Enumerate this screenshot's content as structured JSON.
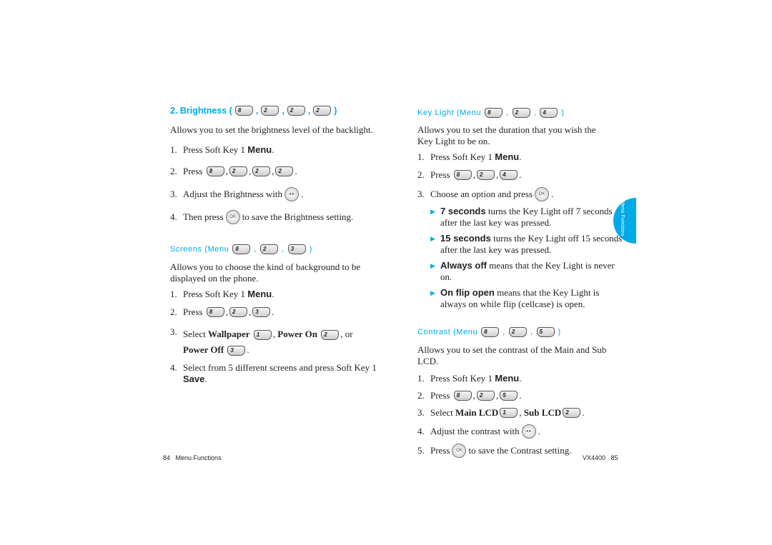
{
  "left_page": {
    "brightness": {
      "heading": "2. Brightness (",
      "heading_close": ")",
      "keys": [
        "8",
        "2",
        "2",
        "2"
      ],
      "description": "Allows you to set the brightness level of the backlight.",
      "steps": [
        {
          "num": "1.",
          "text": "Press Soft Key 1 ",
          "bold": "Menu",
          "end": "."
        },
        {
          "num": "2.",
          "text": "Press",
          "keys": [
            "8",
            "2",
            "2",
            "2"
          ]
        },
        {
          "num": "3.",
          "text": "Adjust the Brightness with",
          "icon": "navigation-key",
          "end": "."
        },
        {
          "num": "4.",
          "text": "Then press",
          "icon": "ok-key",
          "after": "to save the Brightness setting."
        }
      ]
    },
    "screens": {
      "heading": "Screens (Menu",
      "heading_close": ")",
      "keys": [
        "8",
        "2",
        "3"
      ],
      "description": "Allows you to choose the kind of background to be displayed on the phone.",
      "steps": [
        {
          "num": "1.",
          "text": "Press Soft Key 1 ",
          "bold": "Menu",
          "end": "."
        },
        {
          "num": "2.",
          "text": "Press",
          "keys": [
            "8",
            "2",
            "3"
          ]
        },
        {
          "num": "3.",
          "text": "Select",
          "options": [
            "Wallpaper",
            "Power On",
            "Power Off"
          ],
          "option_keys": [
            "1",
            "2",
            "3"
          ]
        },
        {
          "num": "4.",
          "text": "Select from 5 different screens and press Soft Key 1 ",
          "bold": "Save",
          "end": "."
        }
      ]
    },
    "footer": {
      "page": "84",
      "title": "Menu Functions"
    }
  },
  "right_page": {
    "key_light": {
      "heading": "Key Light (Menu",
      "heading_close": ")",
      "keys": [
        "8",
        "2",
        "4"
      ],
      "description": "Allows you to set the duration that you wish the Key Light to be on.",
      "steps": [
        {
          "num": "1.",
          "text": "Press Soft Key 1 ",
          "bold": "Menu",
          "end": "."
        },
        {
          "num": "2.",
          "text": "Press",
          "keys": [
            "8",
            "2",
            "4"
          ]
        },
        {
          "num": "3.",
          "text": "Choose an option and press",
          "icon": "ok-key",
          "end": "."
        }
      ],
      "options": [
        {
          "bold": "7 seconds",
          "text": " turns the Key Light off 7 seconds after the last key was pressed."
        },
        {
          "bold": "15 seconds",
          "text": " turns the Key Light off 15 seconds after the last key was pressed."
        },
        {
          "bold": "Always off",
          "text": " means that the Key Light is never on."
        },
        {
          "bold": "On flip open",
          "text": " means that the Key Light is always on while flip (cellcase) is open."
        }
      ]
    },
    "contrast": {
      "heading": "Contrast (Menu",
      "heading_close": ")",
      "keys": [
        "8",
        "2",
        "5"
      ],
      "description": "Allows you to set the contrast of the Main and Sub LCD.",
      "steps": [
        {
          "num": "1.",
          "text": "Press Soft Key 1 ",
          "bold": "Menu",
          "end": "."
        },
        {
          "num": "2.",
          "text": "Press",
          "keys": [
            "8",
            "2",
            "5"
          ]
        },
        {
          "num": "3.",
          "text": "Select",
          "options": [
            "Main LCD",
            "Sub LCD"
          ],
          "option_keys": [
            "1",
            "2"
          ]
        },
        {
          "num": "4.",
          "text": "Adjust the contrast with",
          "icon": "navigation-key",
          "end": "."
        },
        {
          "num": "5.",
          "text": "Press",
          "icon": "ok-key",
          "after": "to save the Contrast setting."
        }
      ]
    },
    "side_tab": "Menu Functions",
    "footer": {
      "model": "VX4400",
      "page": "85"
    }
  },
  "colors": {
    "accent": "#00a9e8",
    "text": "#231f20"
  }
}
